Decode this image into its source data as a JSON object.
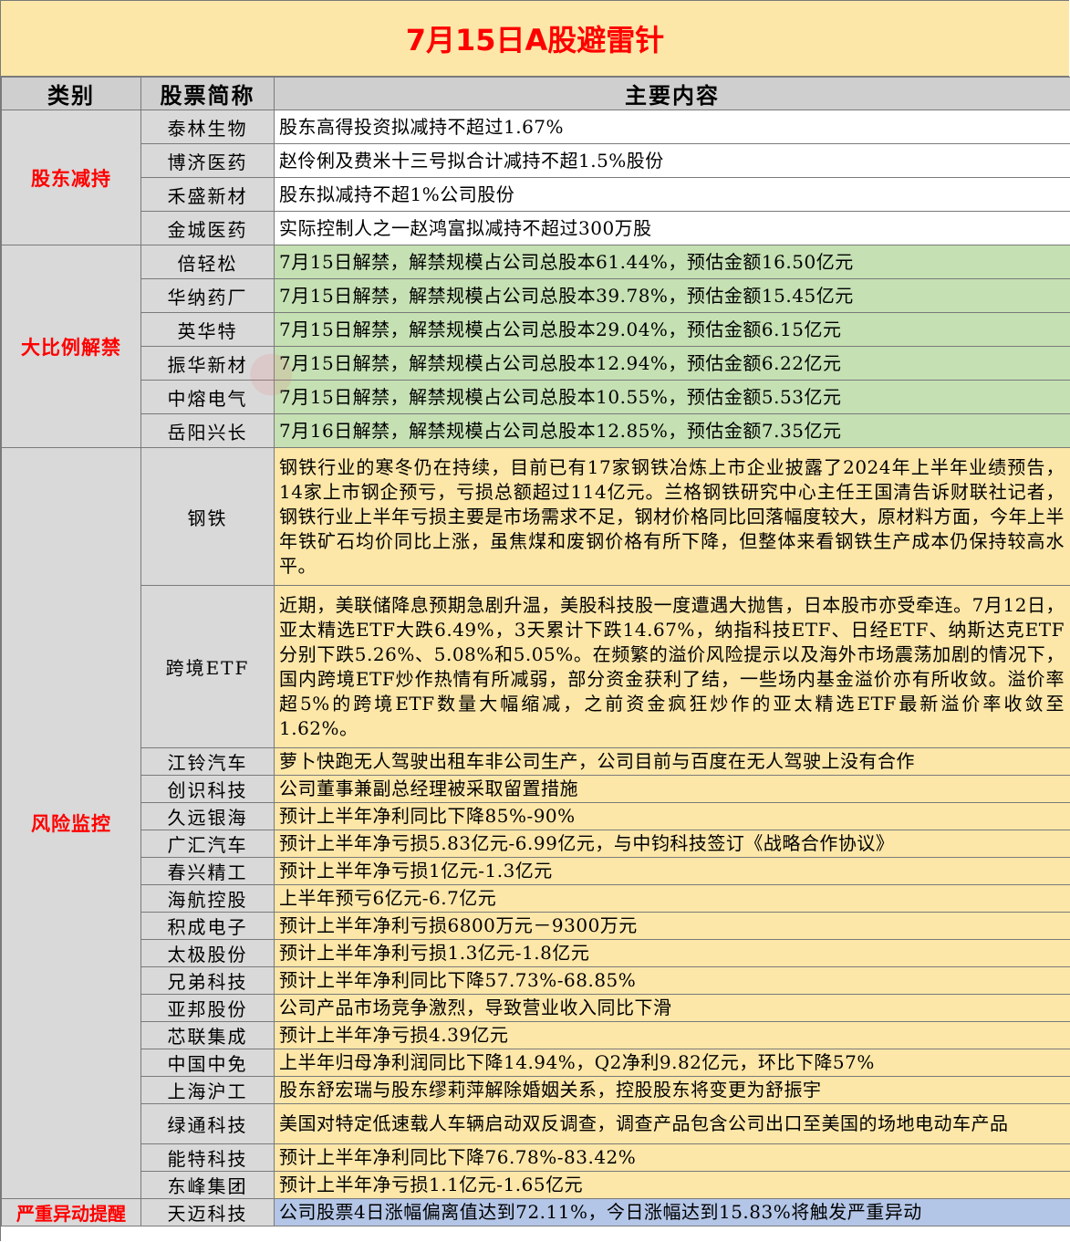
{
  "title": "7月15日A股避雷针",
  "headers": {
    "category": "类别",
    "stock": "股票简称",
    "content": "主要内容"
  },
  "sections": [
    {
      "category": "股东减持",
      "color": "#ffffff",
      "rows": [
        {
          "name": "泰林生物",
          "content": "股东高得投资拟减持不超过1.67%"
        },
        {
          "name": "博济医药",
          "content": "赵伶俐及费米十三号拟合计减持不超1.5%股份"
        },
        {
          "name": "禾盛新材",
          "content": "股东拟减持不超1%公司股份"
        },
        {
          "name": "金城医药",
          "content": "实际控制人之一赵鸿富拟减持不超过300万股"
        }
      ]
    },
    {
      "category": "大比例解禁",
      "color": "#c5e0b3",
      "rows": [
        {
          "name": "倍轻松",
          "content": "7月15日解禁，解禁规模占公司总股本61.44%，预估金额16.50亿元"
        },
        {
          "name": "华纳药厂",
          "content": "7月15日解禁，解禁规模占公司总股本39.78%，预估金额15.45亿元"
        },
        {
          "name": "英华特",
          "content": "7月15日解禁，解禁规模占公司总股本29.04%，预估金额6.15亿元"
        },
        {
          "name": "振华新材",
          "content": "7月15日解禁，解禁规模占公司总股本12.94%，预估金额6.22亿元"
        },
        {
          "name": "中熔电气",
          "content": "7月15日解禁，解禁规模占公司总股本10.55%，预估金额5.53亿元"
        },
        {
          "name": "岳阳兴长",
          "content": "7月16日解禁，解禁规模占公司总股本12.85%，预估金额7.35亿元"
        }
      ]
    },
    {
      "category": "风险监控",
      "color": "#fde7a8",
      "rows": [
        {
          "name": "钢铁",
          "content": "钢铁行业的寒冬仍在持续，目前已有17家钢铁冶炼上市企业披露了2024年上半年业绩预告，14家上市钢企预亏，亏损总额超过114亿元。兰格钢铁研究中心主任王国清告诉财联社记者，钢铁行业上半年亏损主要是市场需求不足，钢材价格同比回落幅度较大，原材料方面，今年上半年铁矿石均价同比上涨，虽焦煤和废钢价格有所下降，但整体来看钢铁生产成本仍保持较高水平。"
        },
        {
          "name": "跨境ETF",
          "content": "近期，美联储降息预期急剧升温，美股科技股一度遭遇大抛售，日本股市亦受牵连。7月12日，亚太精选ETF大跌6.49%，3天累计下跌14.67%，纳指科技ETF、日经ETF、纳斯达克ETF分别下跌5.26%、5.08%和5.05%。在频繁的溢价风险提示以及海外市场震荡加剧的情况下，国内跨境ETF炒作热情有所减弱，部分资金获利了结，一些场内基金溢价亦有所收敛。溢价率超5%的跨境ETF数量大幅缩减，之前资金疯狂炒作的亚太精选ETF最新溢价率收敛至1.62%。"
        },
        {
          "name": "江铃汽车",
          "content": "萝卜快跑无人驾驶出租车非公司生产，公司目前与百度在无人驾驶上没有合作"
        },
        {
          "name": "创识科技",
          "content": "公司董事兼副总经理被采取留置措施"
        },
        {
          "name": "久远银海",
          "content": "预计上半年净利同比下降85%-90%"
        },
        {
          "name": "广汇汽车",
          "content": "预计上半年净亏损5.83亿元-6.99亿元，与中钧科技签订《战略合作协议》"
        },
        {
          "name": "春兴精工",
          "content": "预计上半年净亏损1亿元-1.3亿元"
        },
        {
          "name": "海航控股",
          "content": "上半年预亏6亿元-6.7亿元"
        },
        {
          "name": "积成电子",
          "content": "预计上半年净利亏损6800万元－9300万元"
        },
        {
          "name": "太极股份",
          "content": "预计上半年净利亏损1.3亿元-1.8亿元"
        },
        {
          "name": "兄弟科技",
          "content": "预计上半年净利同比下降57.73%-68.85%"
        },
        {
          "name": "亚邦股份",
          "content": "公司产品市场竞争激烈，导致营业收入同比下滑"
        },
        {
          "name": "芯联集成",
          "content": "预计上半年净亏损4.39亿元"
        },
        {
          "name": "中国中免",
          "content": "上半年归母净利润同比下降14.94%，Q2净利9.82亿元，环比下降57%"
        },
        {
          "name": "上海沪工",
          "content": "股东舒宏瑞与股东缪莉萍解除婚姻关系，控股股东将变更为舒振宇"
        },
        {
          "name": "绿通科技",
          "content": "美国对特定低速载人车辆启动双反调查，调查产品包含公司出口至美国的场地电动车产品"
        },
        {
          "name": "能特科技",
          "content": "预计上半年净利同比下降76.78%-83.42%"
        },
        {
          "name": "东峰集团",
          "content": "预计上半年净亏损1.1亿元-1.65亿元"
        }
      ]
    },
    {
      "category": "严重异动提醒",
      "color": "#b4c6e7",
      "rows": [
        {
          "name": "天迈科技",
          "content": "公司股票4日涨幅偏离值达到72.11%，今日涨幅达到15.83%将触发严重异动"
        }
      ]
    }
  ]
}
